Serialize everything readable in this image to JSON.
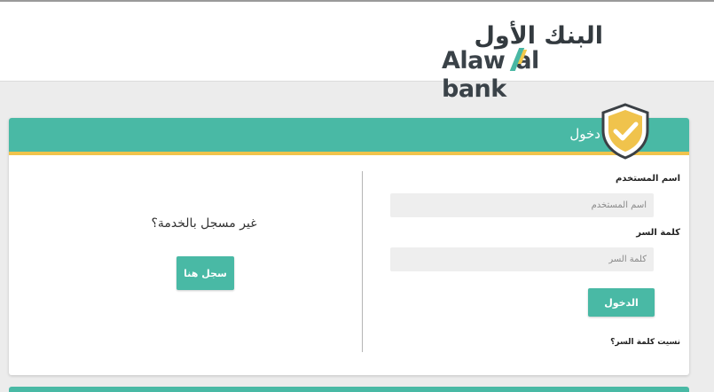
{
  "brand": {
    "name_ar": "البنك الأول",
    "name_en_left": "Alaw",
    "name_en_right": "al bank",
    "colors": {
      "teal": "#49b9a5",
      "gold": "#f0c34c",
      "dark": "#333a3f"
    }
  },
  "login": {
    "title": "دخول",
    "shield_icon": "shield-check-icon",
    "username_label": "اسم المستخدم",
    "username_placeholder": "اسم المستخدم",
    "username_value": "",
    "password_label": "كلمة السر",
    "password_placeholder": "كلمة السر",
    "password_value": "",
    "submit_label": "الدخول",
    "forgot_label": "نسيت كلمة السر؟"
  },
  "register": {
    "prompt": "غير مسجل بالخدمة؟",
    "button_label": "سجل هنا"
  }
}
